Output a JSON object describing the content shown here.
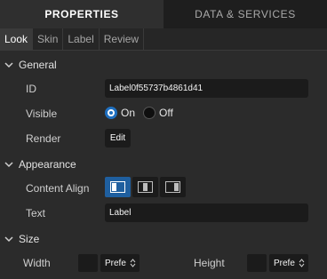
{
  "top_tabs": [
    {
      "label": "PROPERTIES",
      "active": true
    },
    {
      "label": "DATA & SERVICES",
      "active": false
    }
  ],
  "sub_tabs": [
    {
      "label": "Look",
      "active": true
    },
    {
      "label": "Skin",
      "active": false
    },
    {
      "label": "Label",
      "active": false
    },
    {
      "label": "Review",
      "active": false
    }
  ],
  "general": {
    "header": "General",
    "id_label": "ID",
    "id_value": "Label0f55737b4861d41",
    "visible_label": "Visible",
    "visible_on": "On",
    "visible_off": "Off",
    "visible_selected": "On",
    "render_label": "Render",
    "render_button": "Edit"
  },
  "appearance": {
    "header": "Appearance",
    "content_align_label": "Content Align",
    "content_align_selected": "left",
    "text_label": "Text",
    "text_value": "Label"
  },
  "size": {
    "header": "Size",
    "width_label": "Width",
    "width_unit": "Prefe",
    "height_label": "Height",
    "height_unit": "Prefe"
  },
  "colors": {
    "accent": "#1f6fbf",
    "panel_bg": "#2b2b2b",
    "field_bg": "#1b1b1b"
  }
}
